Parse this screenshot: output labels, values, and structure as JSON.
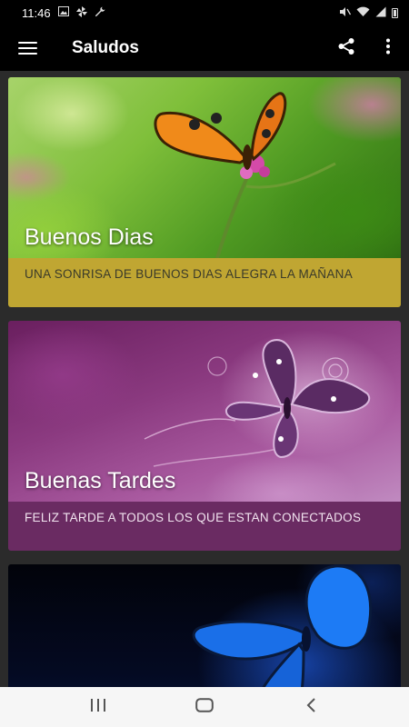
{
  "status_bar": {
    "time": "11:46",
    "left_icons": [
      "image-icon",
      "pinwheel-icon",
      "wrench-icon"
    ],
    "right_icons": [
      "mute-icon",
      "wifi-icon",
      "signal-icon",
      "battery-icon"
    ]
  },
  "app_bar": {
    "title": "Saludos",
    "menu_icon": "hamburger-icon",
    "share_icon": "share-icon",
    "more_icon": "more-vert-icon"
  },
  "cards": [
    {
      "title": "Buenos Dias",
      "caption": "UNA SONRISA DE BUENOS DIAS ALEGRA LA MAÑANA",
      "image": "butterfly-on-flower-green",
      "caption_color": "#c0a632"
    },
    {
      "title": "Buenas Tardes",
      "caption": "FELIZ TARDE A TODOS LOS QUE ESTAN CONECTADOS",
      "image": "purple-butterfly-art",
      "caption_color": "#6a2b62"
    },
    {
      "title": "",
      "caption": "",
      "image": "blue-butterfly-dark"
    }
  ],
  "nav_bar": {
    "recents_icon": "recents-icon",
    "home_icon": "home-icon",
    "back_icon": "back-icon"
  }
}
